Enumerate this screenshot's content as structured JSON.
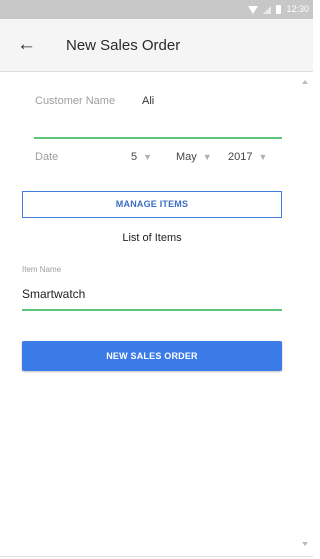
{
  "status_bar": {
    "time": "12:30",
    "icons": [
      "wifi-icon",
      "signal-icon",
      "battery-icon"
    ]
  },
  "app_bar": {
    "back_icon": "arrow-left-icon",
    "back_glyph": "←",
    "title": "New Sales Order"
  },
  "form": {
    "customer": {
      "label": "Customer Name",
      "value": "Ali"
    },
    "date": {
      "label": "Date",
      "day": "5",
      "month": "May",
      "year": "2017",
      "caret_glyph": "▼"
    },
    "manage_items_label": "MANAGE ITEMS",
    "list_heading": "List of Items",
    "item": {
      "label": "Item Name",
      "value": "Smartwatch"
    },
    "submit_label": "NEW SALES ORDER"
  },
  "colors": {
    "accent_blue": "#3a7be8",
    "underline_green": "#5cc57a",
    "status_bar": "#c7c7c7",
    "app_bar": "#f5f5f5"
  }
}
